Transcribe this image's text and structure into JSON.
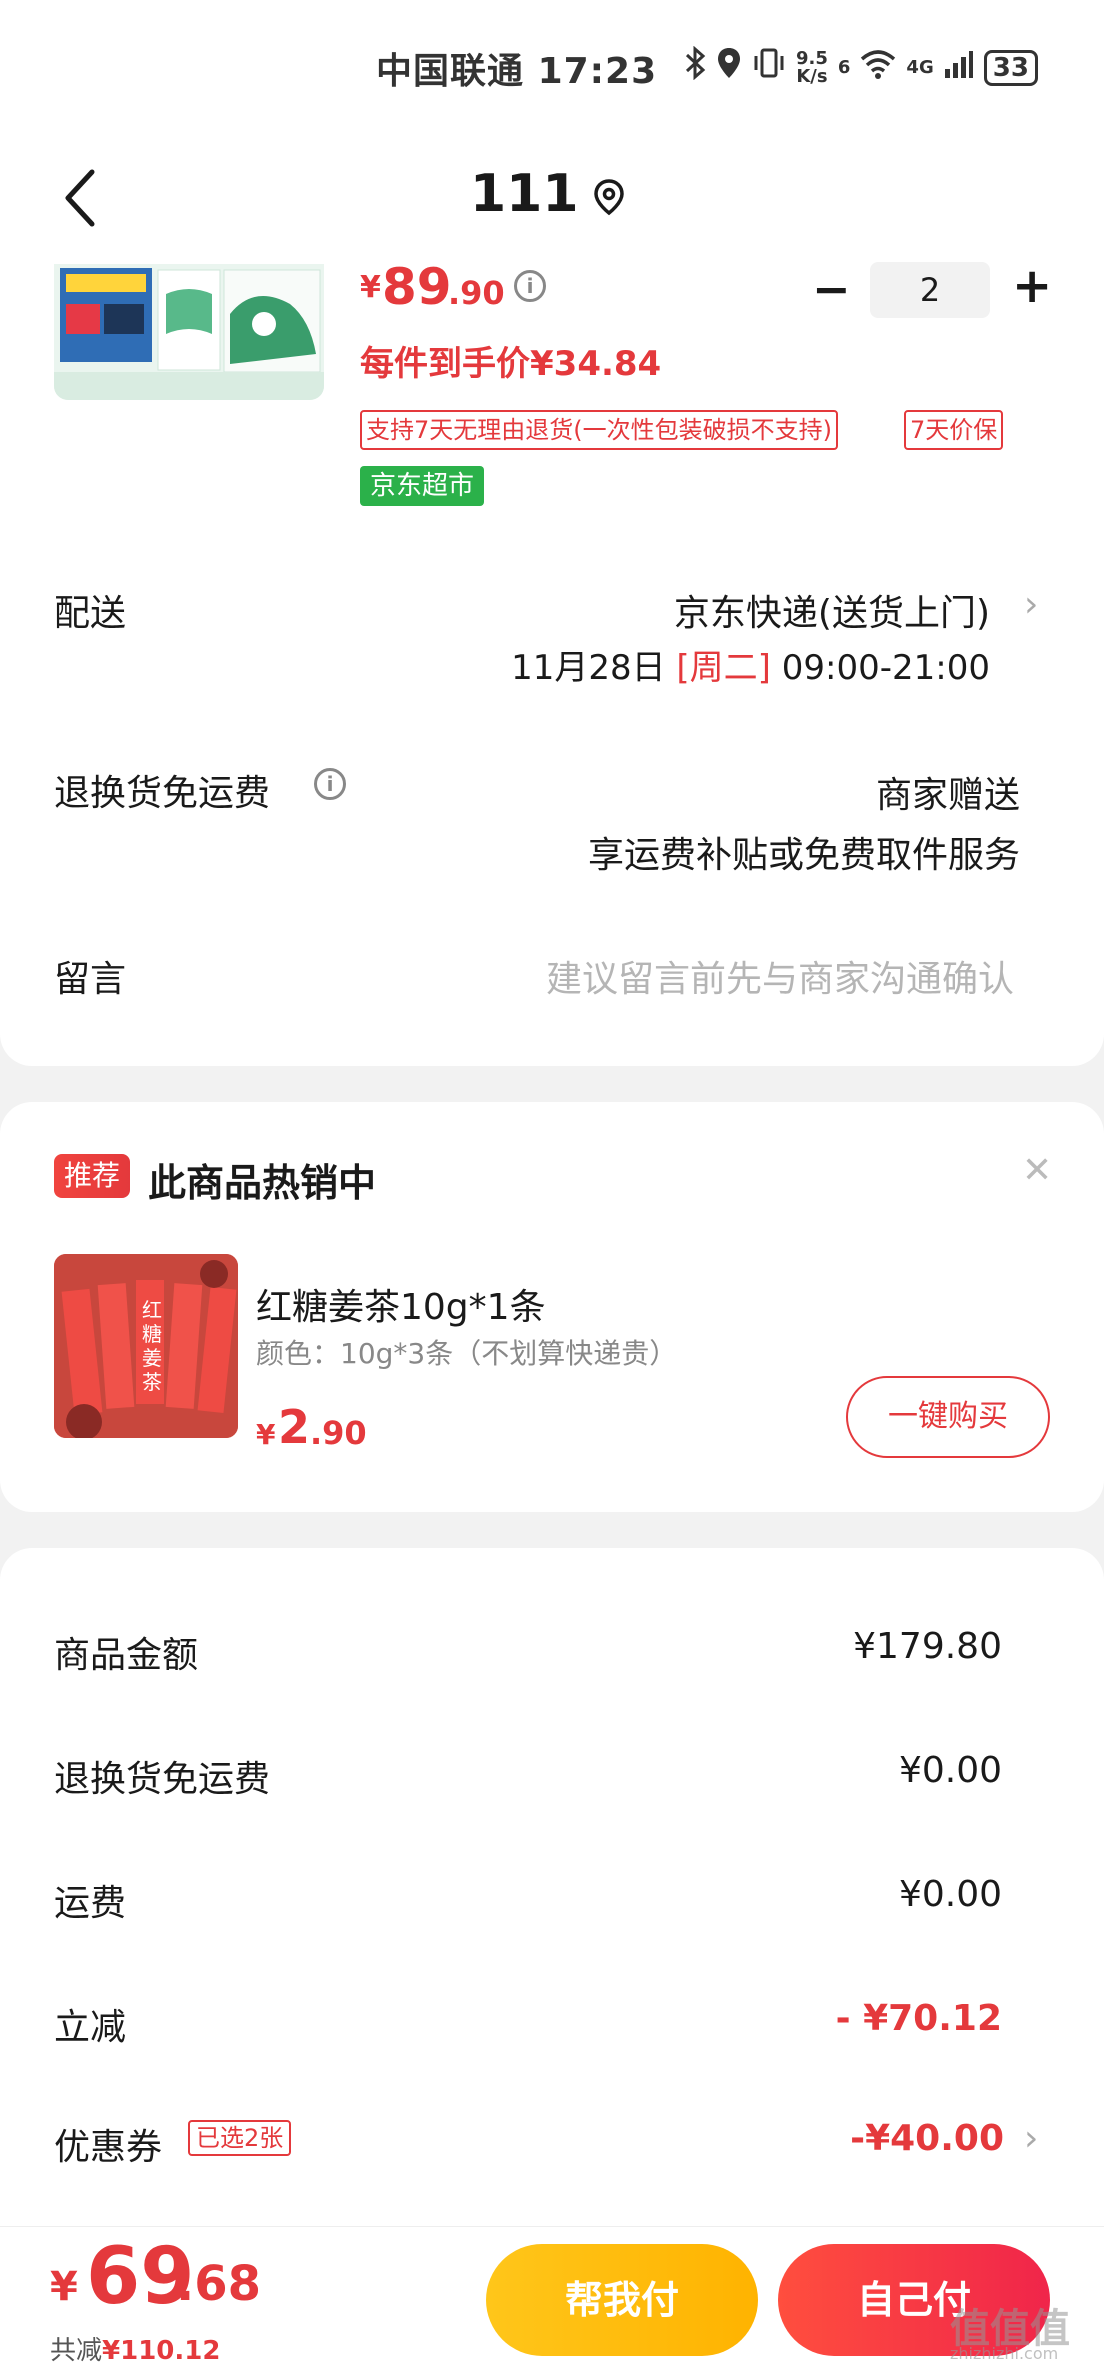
{
  "status_bar": {
    "carrier": "中国联通",
    "time": "17:23",
    "speed_value": "9.5",
    "speed_unit": "K/s",
    "network_6": "6",
    "network_4g": "4G",
    "battery": "33"
  },
  "header": {
    "title": "111"
  },
  "product": {
    "price_yen": "¥",
    "price_int": "89",
    "price_dec": ".90",
    "unit_price_label": "每件到手价¥34.84",
    "quantity": "2",
    "minus": "−",
    "plus": "+",
    "tag_return": "支持7天无理由退货(一次性包装破损不支持)",
    "tag_price_protect": "7天价保",
    "tag_store": "京东超市"
  },
  "delivery": {
    "label": "配送",
    "method": "京东快递(送货上门)",
    "date": "11月28日",
    "weekday": "[周二]",
    "time_window": "09:00-21:00"
  },
  "return_shipping": {
    "label": "退换货免运费",
    "value_line1": "商家赠送",
    "value_line2": "享运费补贴或免费取件服务"
  },
  "message": {
    "label": "留言",
    "placeholder": "建议留言前先与商家沟通确认"
  },
  "recommend": {
    "badge": "推荐",
    "title": "此商品热销中",
    "product_name": "红糖姜茶10g*1条",
    "spec": "颜色：10g*3条（不划算快递贵）",
    "price_yen": "¥",
    "price_int": "2",
    "price_dec": ".90",
    "buy_label": "一键购买",
    "image_text": "红糖姜茶"
  },
  "summary": {
    "goods_amount_label": "商品金额",
    "goods_amount_value": "¥179.80",
    "return_fee_label": "退换货免运费",
    "return_fee_value": "¥0.00",
    "shipping_label": "运费",
    "shipping_value": "¥0.00",
    "discount_label": "立减",
    "discount_value": "- ¥70.12",
    "coupon_label": "优惠券",
    "coupon_tag": "已选2张",
    "coupon_value": "-¥40.00"
  },
  "bottom": {
    "total_yen": "¥",
    "total_int": "69",
    "total_dec": ".68",
    "saved_prefix": "共减",
    "saved_value": "¥110.12",
    "help_pay": "帮我付",
    "self_pay": "自己付",
    "watermark": "值值值",
    "watermark_sub": "zhizhizhi.com"
  },
  "icons": {
    "back": "back-arrow-icon",
    "location": "location-pin-icon",
    "info": "info-icon",
    "chevron": "chevron-right-icon",
    "close": "close-icon"
  },
  "colors": {
    "accent_red": "#e4393c",
    "green_tag": "#2bb14a",
    "yellow_button": "#ffb300"
  }
}
